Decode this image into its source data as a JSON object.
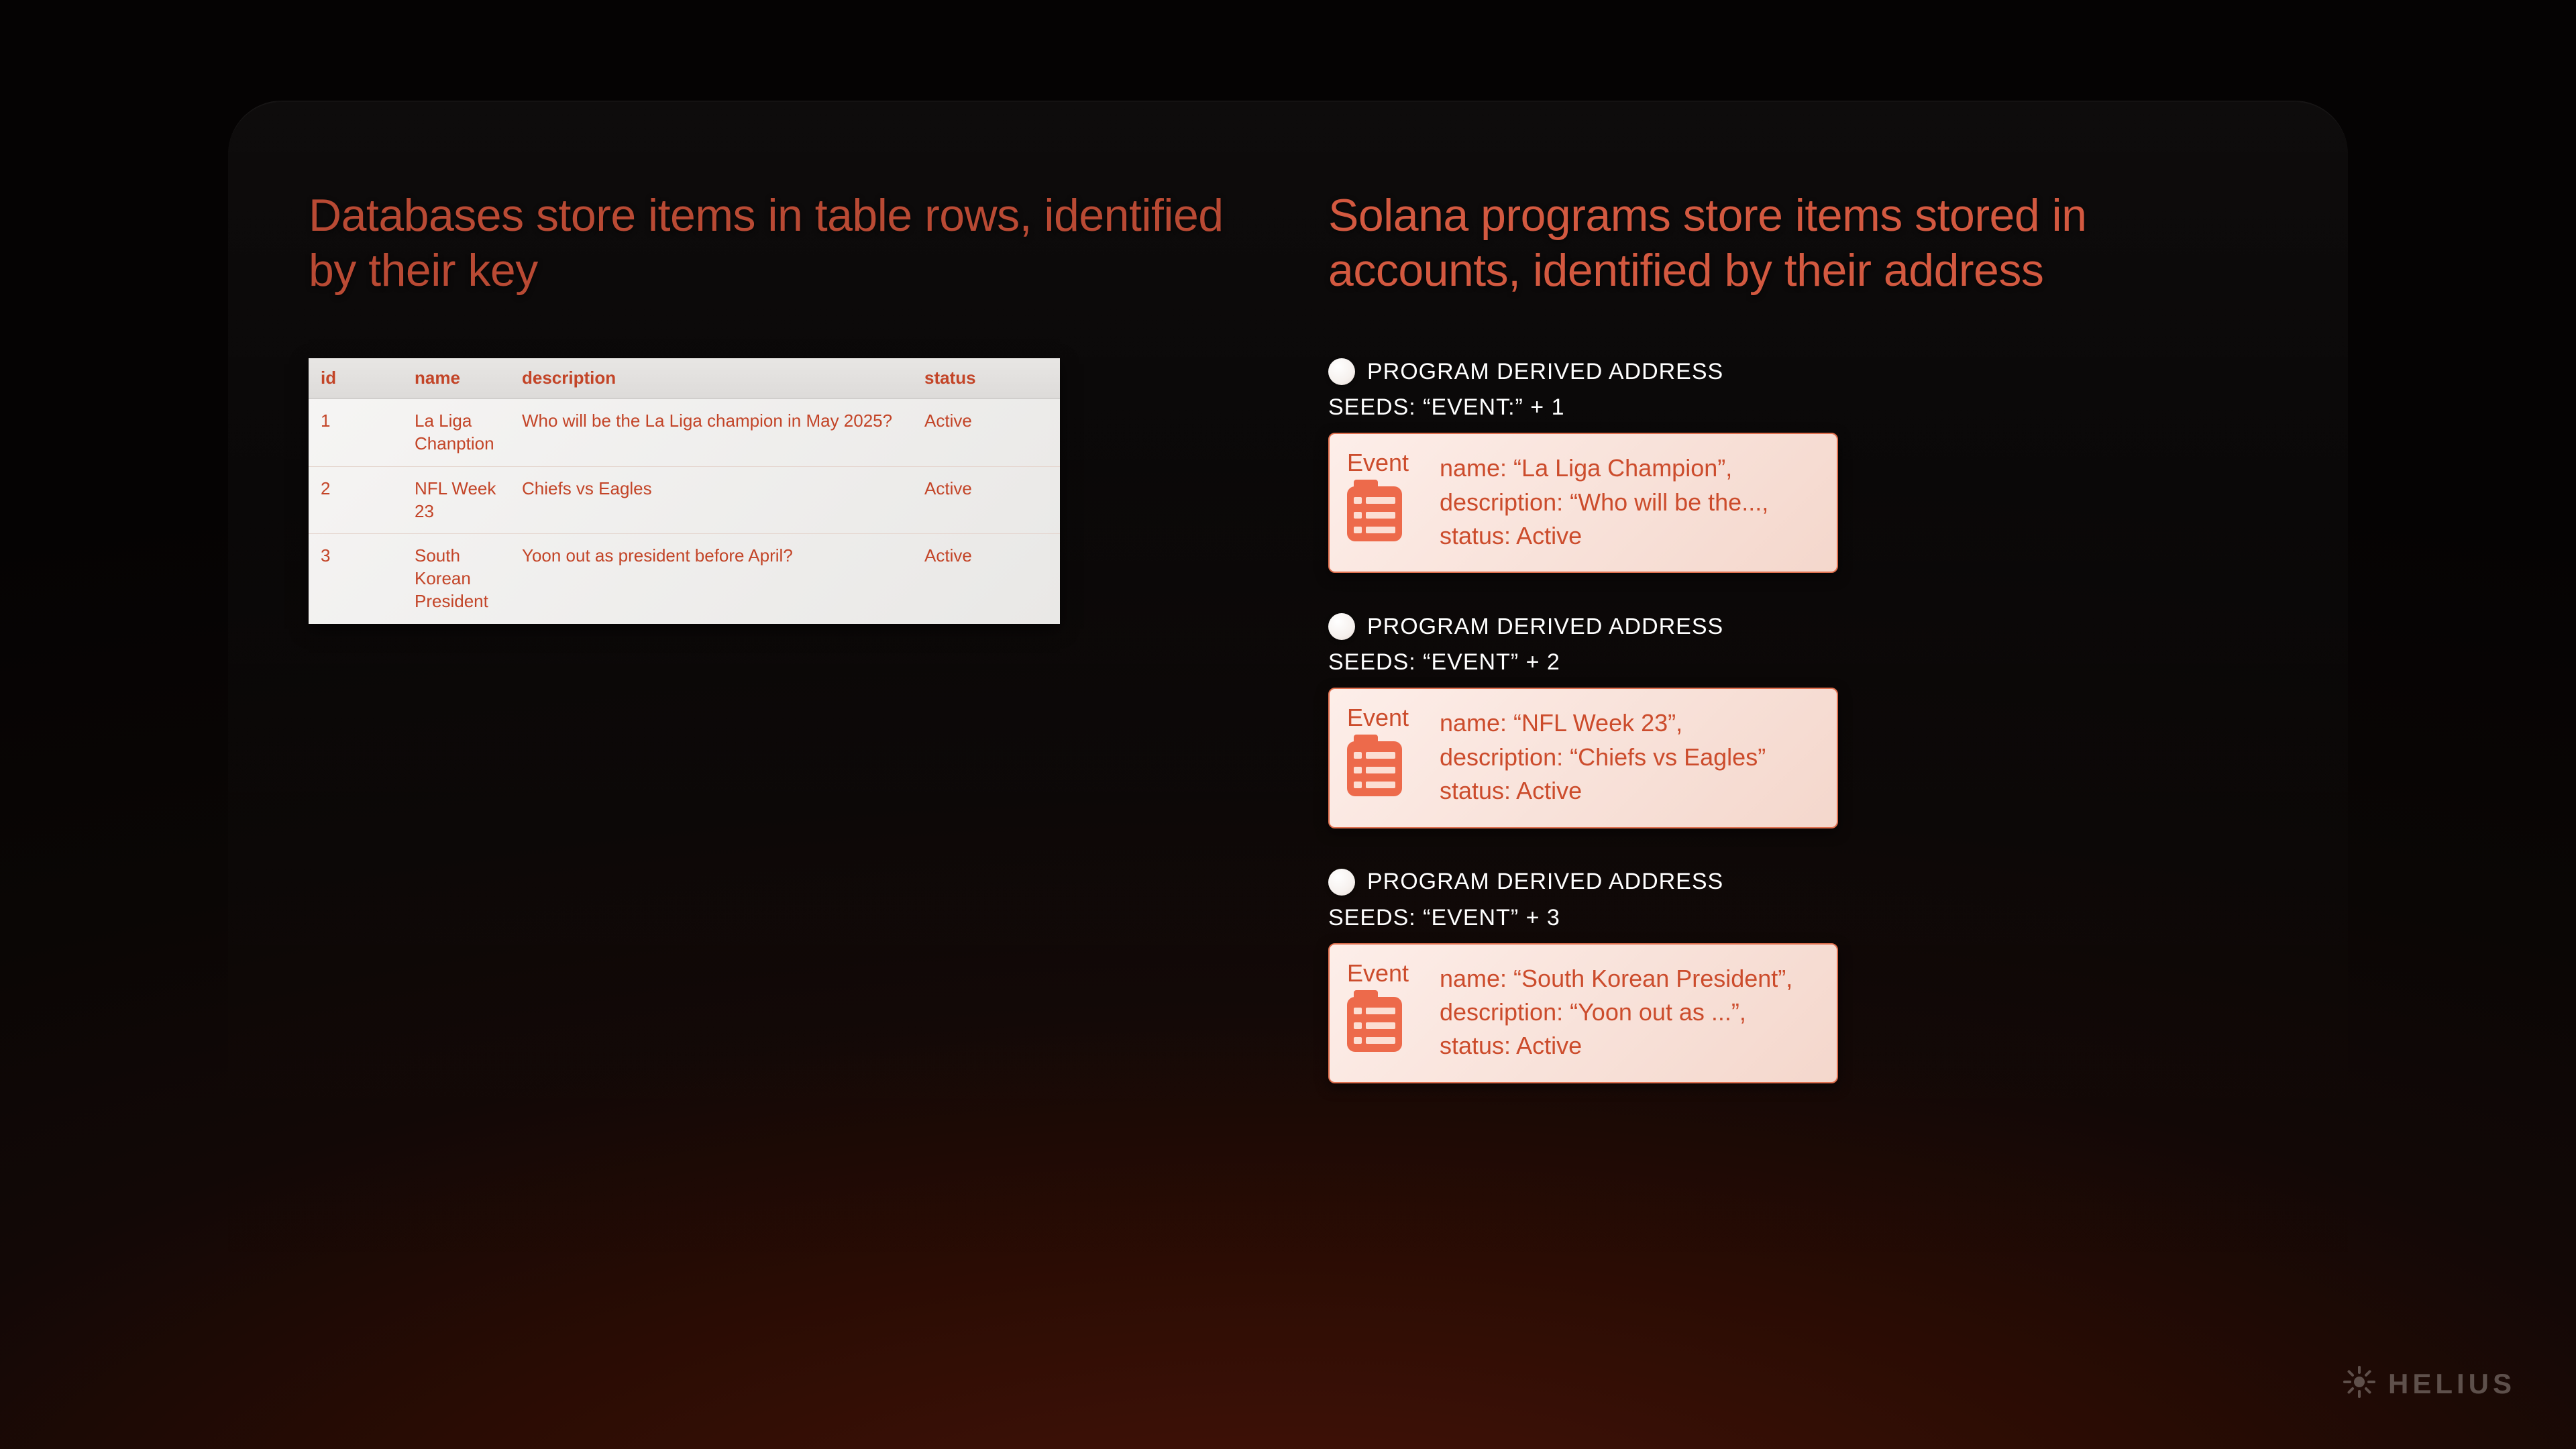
{
  "left": {
    "heading": "Databases store items in table rows, identified by their key",
    "table": {
      "headers": {
        "id": "id",
        "name": "name",
        "description": "description",
        "status": "status"
      },
      "rows": [
        {
          "id": "1",
          "name": "La Liga Chanption",
          "description": "Who will be the La Liga champion in May 2025?",
          "status": "Active"
        },
        {
          "id": "2",
          "name": "NFL Week 23",
          "description": "Chiefs vs Eagles",
          "status": "Active"
        },
        {
          "id": "3",
          "name": "South Korean President",
          "description": "Yoon out as president before April?",
          "status": "Active"
        }
      ]
    }
  },
  "right": {
    "heading": "Solana programs store items stored in accounts, identified by their address",
    "pda_label": "PROGRAM DERIVED ADDRESS",
    "event_label": "Event",
    "cards": [
      {
        "seeds": "SEEDS: “EVENT:” + 1",
        "body": "name: “La Liga Champion”,\ndescription: “Who will be the...,\nstatus: Active"
      },
      {
        "seeds": "SEEDS: “EVENT” + 2",
        "body": "name: “NFL Week 23”,\ndescription: “Chiefs vs Eagles”\nstatus: Active"
      },
      {
        "seeds": "SEEDS: “EVENT” + 3",
        "body": "name: “South Korean President”,\ndescription: “Yoon out as ...”,\nstatus: Active"
      }
    ]
  },
  "brand": "HELIUS"
}
